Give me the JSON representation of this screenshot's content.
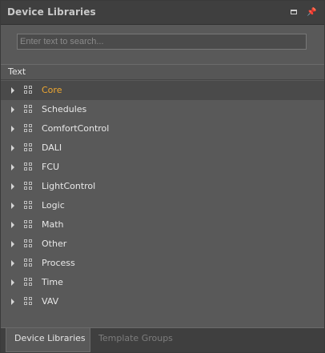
{
  "panel": {
    "title": "Device Libraries",
    "maximize_icon": "maximize-icon",
    "pin_icon": "pin-icon"
  },
  "search": {
    "placeholder": "Enter text to search..."
  },
  "column_header": {
    "label": "Text"
  },
  "tree": {
    "items": [
      {
        "label": "Core",
        "selected": true
      },
      {
        "label": "Schedules"
      },
      {
        "label": "ComfortControl"
      },
      {
        "label": "DALI"
      },
      {
        "label": "FCU"
      },
      {
        "label": "LightControl"
      },
      {
        "label": "Logic"
      },
      {
        "label": "Math"
      },
      {
        "label": "Other"
      },
      {
        "label": "Process"
      },
      {
        "label": "Time"
      },
      {
        "label": "VAV"
      }
    ]
  },
  "tabs": [
    {
      "label": "Device Libraries",
      "active": true
    },
    {
      "label": "Template Groups",
      "active": false
    }
  ],
  "colors": {
    "selected_text": "#f0a830",
    "background": "#595959",
    "titlebar": "#3f3f3f"
  }
}
